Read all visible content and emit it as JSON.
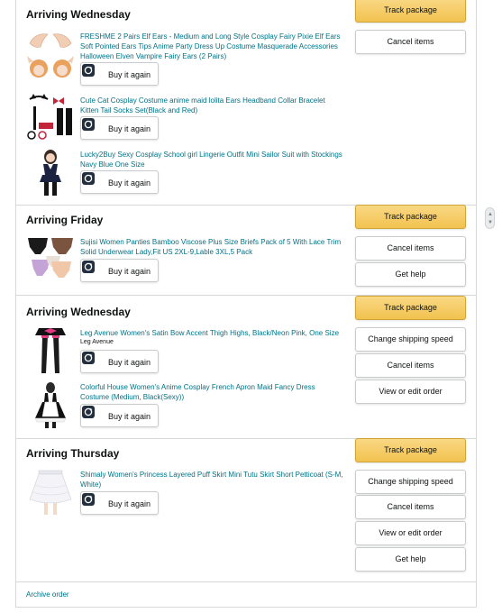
{
  "sections": [
    {
      "heading": "Arriving Wednesday",
      "items": [
        {
          "title": "FRESHME 2 Pairs Elf Ears - Medium and Long Style Cosplay Fairy Pixie Elf Ears Soft Pointed Ears Tips Anime Party Dress Up Costume Masquerade Accessories Halloween Elven Vampire Fairy Ears (2 Pairs)",
          "buy_label": "Buy it again"
        },
        {
          "title": "Cute Cat Cosplay Costume anime maid lolita Ears Headband Collar Bracelet Kitten Tail Socks Set(Black and Red)",
          "buy_label": "Buy it again"
        },
        {
          "title": "Lucky2Buy Sexy Cosplay School girl Lingerie Outfit Mini Sailor Suit with Stockings Navy Blue One Size",
          "buy_label": "Buy it again"
        }
      ],
      "actions": [
        "Track package",
        "Cancel items"
      ]
    },
    {
      "heading": "Arriving Friday",
      "items": [
        {
          "title": "Sujisi Women Panties Bamboo Viscose Plus Size Briefs Pack of 5 With Lace Trim Solid Underwear Lady,Fit US 2XL-9,Lable 3XL,5 Pack",
          "buy_label": "Buy it again"
        }
      ],
      "actions": [
        "Track package",
        "Cancel items",
        "Get help"
      ]
    },
    {
      "heading": "Arriving Wednesday",
      "items": [
        {
          "title": "Leg Avenue Women's Satin Bow Accent Thigh Highs, Black/Neon Pink, One Size",
          "seller": "Leg Avenue",
          "buy_label": "Buy it again"
        },
        {
          "title": "Colorful House Women's Anime Cosplay French Apron Maid Fancy Dress Costume (Medium, Black(Sexy))",
          "buy_label": "Buy it again"
        }
      ],
      "actions": [
        "Track package",
        "Change shipping speed",
        "Cancel items",
        "View or edit order"
      ]
    },
    {
      "heading": "Arriving Thursday",
      "items": [
        {
          "title": "Shimaly Women's Princess Layered Puff Skirt Mini Tutu Skirt Short Petticoat (S-M, White)",
          "buy_label": "Buy it again"
        }
      ],
      "actions": [
        "Track package",
        "Change shipping speed",
        "Cancel items",
        "View or edit order",
        "Get help"
      ]
    }
  ],
  "footer": {
    "archive_label": "Archive order"
  },
  "colors": {
    "link": "#007185",
    "track_button": "#f2c24f",
    "border": "#d5d9d9"
  }
}
